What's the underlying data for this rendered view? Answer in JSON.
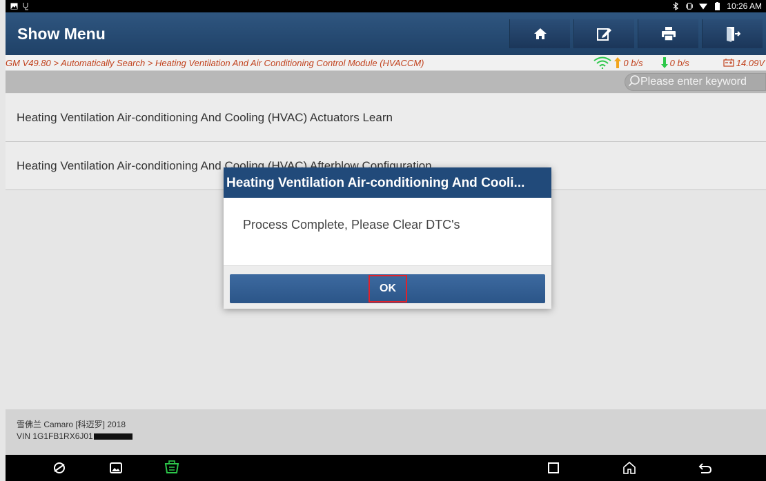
{
  "status_bar": {
    "time": "10:26 AM",
    "icons_left": [
      "image-notification-icon",
      "usb-diagnostic-icon"
    ],
    "icons_right": [
      "bluetooth-icon",
      "vibrate-icon",
      "wifi-icon",
      "battery-icon"
    ]
  },
  "header": {
    "title": "Show Menu",
    "buttons": [
      "home-icon",
      "edit-report-icon",
      "print-icon",
      "exit-icon"
    ]
  },
  "breadcrumb": {
    "path": "GM V49.80 > Automatically Search > Heating Ventilation And Air Conditioning Control Module (HVACCM)",
    "upload_rate": "0 b/s",
    "download_rate": "0 b/s",
    "battery_voltage": "14.09V"
  },
  "search": {
    "placeholder": "Please enter keyword"
  },
  "menu": {
    "items": [
      {
        "label": "Heating Ventilation Air-conditioning And Cooling (HVAC) Actuators Learn"
      },
      {
        "label": "Heating Ventilation Air-conditioning And Cooling (HVAC) Afterblow Configuration"
      }
    ]
  },
  "vehicle": {
    "model": "雪佛兰 Camaro [科迈罗] 2018",
    "vin": "VIN 1G1FB1RX6J01"
  },
  "dialog": {
    "title": "Heating Ventilation Air-conditioning And Cooli...",
    "message": "Process Complete, Please Clear DTC's",
    "ok_label": "OK"
  },
  "colors": {
    "header_blue": "#214a7a",
    "breadcrumb_text": "#c1411c",
    "ok_highlight": "#e0222b",
    "wifi_green": "#2cc84a"
  }
}
